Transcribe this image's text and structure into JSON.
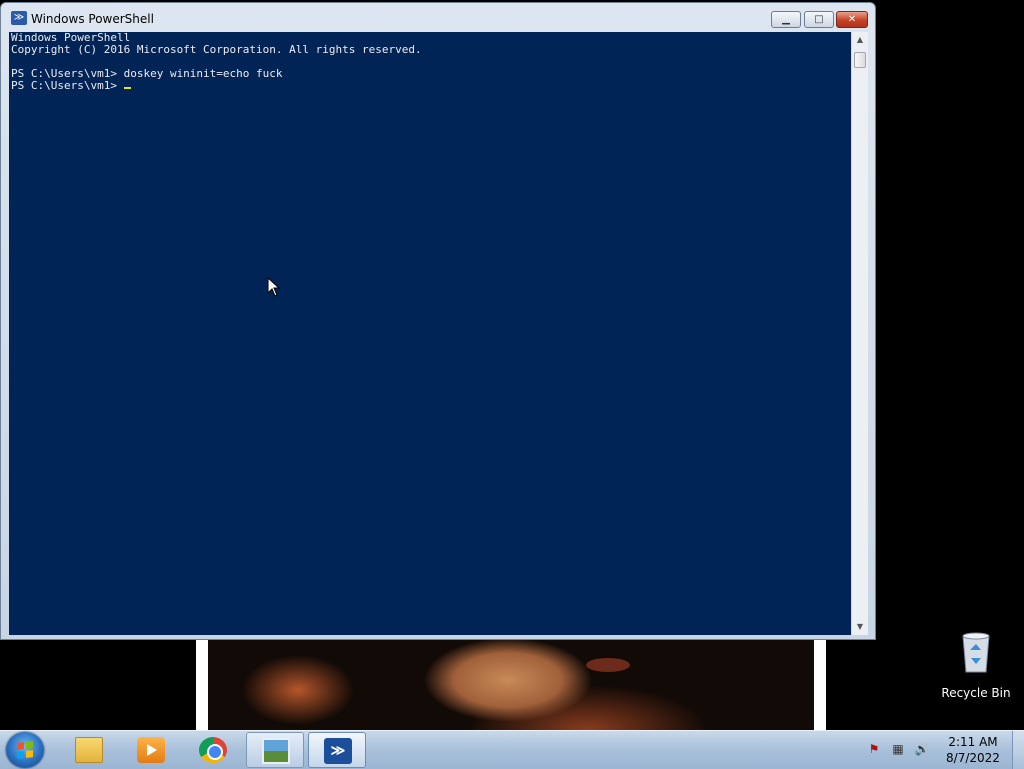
{
  "window": {
    "title": "Windows PowerShell",
    "minimize_glyph": "▁",
    "maximize_glyph": "□",
    "close_glyph": "✕"
  },
  "console": {
    "lines": [
      "Windows PowerShell",
      "Copyright (C) 2016 Microsoft Corporation. All rights reserved.",
      "",
      "PS C:\\Users\\vm1> doskey wininit=echo fuck",
      "PS C:\\Users\\vm1> "
    ],
    "background_color": "#012456",
    "text_color": "#eeedf0"
  },
  "desktop": {
    "recycle_bin_label": "Recycle Bin"
  },
  "taskbar": {
    "pinned_icons": [
      "windows-explorer-icon",
      "media-player-icon",
      "chrome-icon",
      "image-viewer-icon",
      "powershell-icon"
    ],
    "powershell_glyph": "≫",
    "tray_icons": [
      "action-center-flag-icon",
      "network-icon",
      "volume-icon"
    ],
    "clock_time": "2:11 AM",
    "clock_date": "8/7/2022"
  }
}
